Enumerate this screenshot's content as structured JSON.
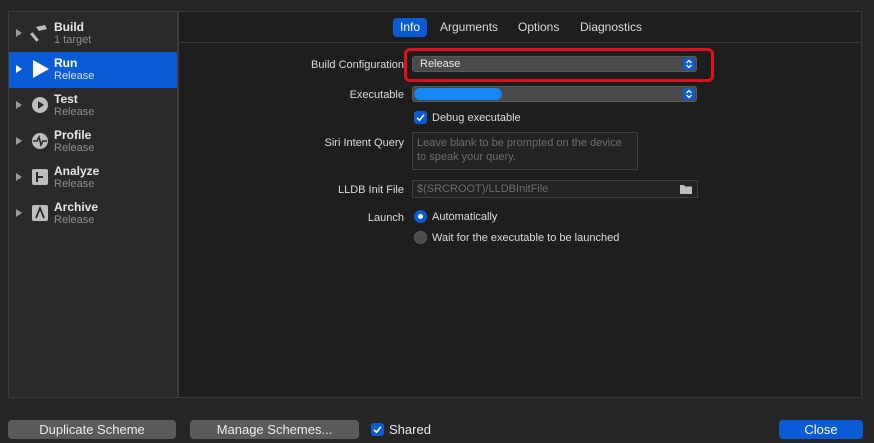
{
  "sidebar": {
    "items": [
      {
        "title": "Build",
        "subtitle": "1 target",
        "icon": "hammer-icon"
      },
      {
        "title": "Run",
        "subtitle": "Release",
        "icon": "play-icon"
      },
      {
        "title": "Test",
        "subtitle": "Release",
        "icon": "wrench-icon"
      },
      {
        "title": "Profile",
        "subtitle": "Release",
        "icon": "waveform-icon"
      },
      {
        "title": "Analyze",
        "subtitle": "Release",
        "icon": "analyze-icon"
      },
      {
        "title": "Archive",
        "subtitle": "Release",
        "icon": "archive-icon"
      }
    ],
    "selected_index": 1
  },
  "tabs": [
    "Info",
    "Arguments",
    "Options",
    "Diagnostics"
  ],
  "active_tab": "Info",
  "form": {
    "build_configuration_label": "Build Configuration",
    "build_configuration_value": "Release",
    "executable_label": "Executable",
    "debug_executable_label": "Debug executable",
    "debug_executable_checked": true,
    "siri_intent_label": "Siri Intent Query",
    "siri_intent_placeholder": "Leave blank to be prompted on the device to speak your query.",
    "lldb_init_label": "LLDB Init File",
    "lldb_init_placeholder": "$(SRCROOT)/LLDBInitFile",
    "launch_label": "Launch",
    "launch_options": [
      "Automatically",
      "Wait for the executable to be launched"
    ],
    "launch_selected": "Automatically"
  },
  "bottom": {
    "duplicate_label": "Duplicate Scheme",
    "manage_label": "Manage Schemes...",
    "shared_label": "Shared",
    "shared_checked": true,
    "close_label": "Close"
  },
  "colors": {
    "accent": "#0a5bd6",
    "highlight_border": "#e3101b",
    "executable_bar": "#1487f2"
  }
}
